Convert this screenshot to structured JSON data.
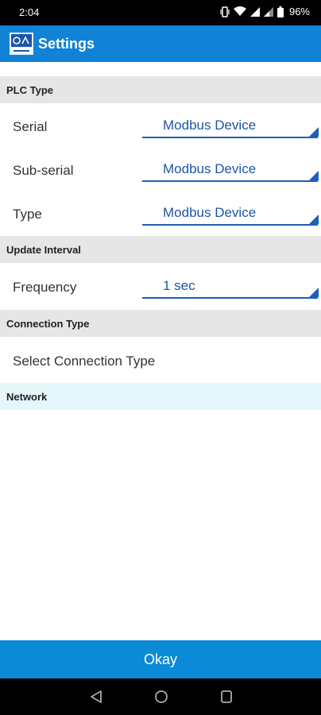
{
  "status_bar": {
    "time": "2:04",
    "battery_percent": "96%",
    "icons": [
      "vibrate-icon",
      "wifi-icon",
      "signal-icon",
      "signal-icon",
      "battery-icon"
    ]
  },
  "app_bar": {
    "title": "Settings",
    "color": "#1183d6"
  },
  "sections": {
    "plc_type": {
      "header": "PLC Type",
      "rows": [
        {
          "label": "Serial",
          "value": "Modbus Device"
        },
        {
          "label": "Sub-serial",
          "value": "Modbus Device"
        },
        {
          "label": "Type",
          "value": "Modbus Device"
        }
      ]
    },
    "update_interval": {
      "header": "Update Interval",
      "rows": [
        {
          "label": "Frequency",
          "value": "1 sec"
        }
      ]
    },
    "connection_type": {
      "header": "Connection Type",
      "select_label": "Select Connection Type"
    },
    "network": {
      "header": "Network"
    }
  },
  "footer": {
    "okay_label": "Okay"
  },
  "nav_bar": {
    "icons": [
      "back-icon",
      "home-icon",
      "recents-icon"
    ]
  },
  "colors": {
    "accent": "#1183d6",
    "spinner_text": "#1d54a8",
    "section_bg": "#e6e6e6",
    "network_bg": "#e6f7fb",
    "button": "#0b8ad8"
  }
}
